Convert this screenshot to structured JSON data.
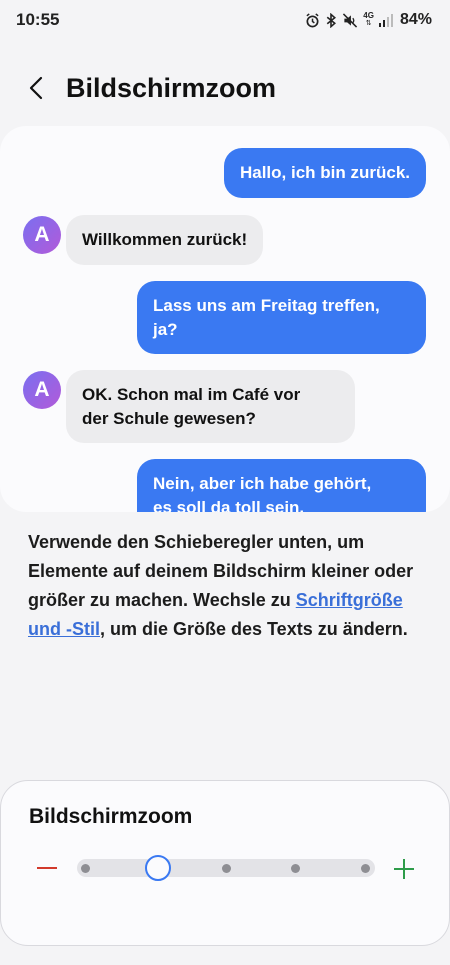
{
  "status_bar": {
    "time": "10:55",
    "network": "4G",
    "battery": "84%",
    "icons": [
      "alarm-icon",
      "bluetooth-icon",
      "mute-icon",
      "network-4g-icon",
      "signal-icon"
    ]
  },
  "header": {
    "back_icon": "chevron-left-icon",
    "title": "Bildschirmzoom"
  },
  "preview": {
    "messages": [
      {
        "direction": "out",
        "text": "Hallo, ich bin zurück."
      },
      {
        "direction": "in",
        "avatar": "A",
        "text": "Willkommen zurück!"
      },
      {
        "direction": "out",
        "line1": "Lass uns am Freitag treffen,",
        "line2": "ja?"
      },
      {
        "direction": "in",
        "avatar": "A",
        "line1": "OK. Schon mal im Café vor",
        "line2": "der Schule gewesen?"
      },
      {
        "direction": "out",
        "line1": "Nein, aber ich habe gehört,",
        "line2": "es soll da toll sein."
      }
    ]
  },
  "description": {
    "text_before": "Verwende den Schieberegler unten, um Elemente auf deinem Bildschirm kleiner oder größer zu machen. Wechsle zu ",
    "link": "Schriftgröße und -Stil",
    "text_after": ", um die Größe des Texts zu ändern."
  },
  "zoom": {
    "title": "Bildschirmzoom",
    "levels": 5,
    "selected_index": 1,
    "accent": "#3a79f2",
    "minus_color": "#d23a2c",
    "plus_color": "#2e9c4a"
  }
}
